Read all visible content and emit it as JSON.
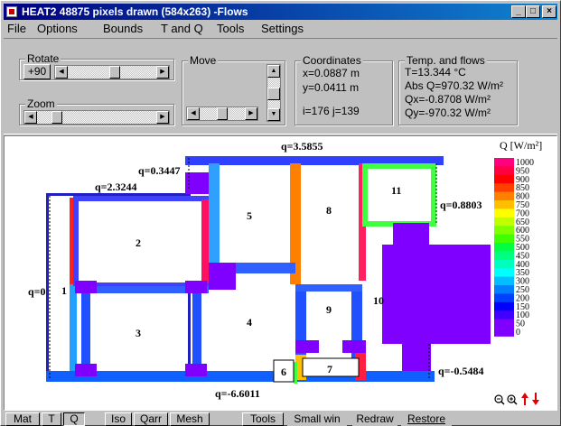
{
  "window": {
    "title": "HEAT2 48875 pixels drawn (584x263) -Flows"
  },
  "menu": [
    "File",
    "Options",
    "Bounds",
    "T and Q",
    "Tools",
    "Settings"
  ],
  "panel": {
    "rotate": {
      "label": "Rotate",
      "button": "+90"
    },
    "zoom": {
      "label": "Zoom"
    },
    "move": {
      "label": "Move"
    },
    "coordinates": {
      "label": "Coordinates",
      "x": "x=0.0887 m",
      "y": "y=0.0411 m",
      "ij": "i=176 j=139"
    },
    "temp": {
      "label": "Temp. and flows",
      "t": "T=13.344 °C",
      "absq": "Abs Q=970.32 W/m²",
      "qx": "Qx=-0.8708 W/m²",
      "qy": "Qy=-970.32 W/m²"
    }
  },
  "legend": {
    "title": "Q [W/m²]",
    "labels": [
      "1000",
      "950",
      "900",
      "850",
      "800",
      "750",
      "700",
      "650",
      "600",
      "550",
      "500",
      "450",
      "400",
      "350",
      "300",
      "250",
      "200",
      "150",
      "100",
      "50",
      "0"
    ],
    "colors": [
      "#ff007f",
      "#ff0040",
      "#ff0000",
      "#ff4000",
      "#ff8000",
      "#ffbf00",
      "#ffff00",
      "#c0ff00",
      "#80ff00",
      "#40ff00",
      "#00ff40",
      "#00ff80",
      "#00ffbf",
      "#00ffff",
      "#00bfff",
      "#0080ff",
      "#0040ff",
      "#0000ff",
      "#4000ff",
      "#8000ff",
      "#8000ff"
    ]
  },
  "annotations": {
    "q_top": "q=3.5855",
    "q_left_upper": "q=0.3447",
    "q_left_mid": "q=2.3244",
    "q_left": "q=0",
    "q_right_upper": "q=0.8803",
    "q_right_lower": "q=-0.5484",
    "q_bottom": "q=-6.6011"
  },
  "regions": [
    "1",
    "2",
    "3",
    "4",
    "5",
    "6",
    "7",
    "8",
    "9",
    "10",
    "11"
  ],
  "statusbar": [
    "Mat",
    "T",
    "Q",
    "Iso",
    "Qarr",
    "Mesh",
    "Tools",
    "Small win",
    "Redraw",
    "Restore"
  ]
}
